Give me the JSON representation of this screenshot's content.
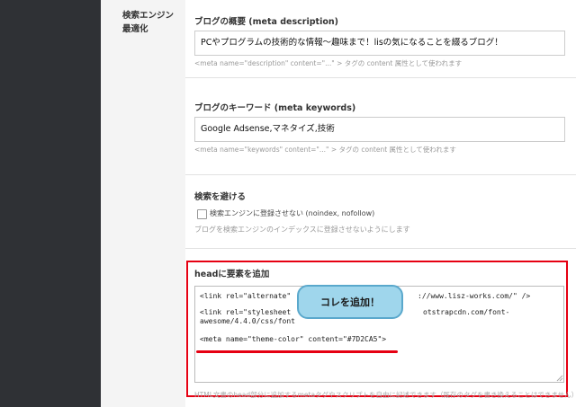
{
  "section_label": "検索エンジン最適化",
  "description": {
    "title": "ブログの概要 (meta description)",
    "value": "PCやプログラムの技術的な情報～趣味まで！lisの気になることを綴るブログ！",
    "hint": "<meta name=\"description\" content=\"...\" > タグの content 属性として使われます"
  },
  "keywords": {
    "title": "ブログのキーワード (meta keywords)",
    "value": "Google Adsense,マネタイズ,技術",
    "hint": "<meta name=\"keywords\" content=\"...\" > タグの content 属性として使われます"
  },
  "noindex": {
    "title": "検索を避ける",
    "checkbox_label": "検索エンジンに登録させない (noindex, nofollow)",
    "checked": false,
    "hint": "ブログを検索エンジンのインデックスに登録させないようにします"
  },
  "head": {
    "title": "headに要素を追加",
    "line1_left": "<link rel=\"alternate\"",
    "line1_right": "://www.lisz-works.com/\" />",
    "line2_left": "<link rel=\"stylesheet",
    "line2_right": "otstrapcdn.com/font-",
    "line3": "awesome/4.4.0/css/font",
    "line4": "<meta name=\"theme-color\" content=\"#7D2CA5\">",
    "hint": "HTML文書のhead部分に追加するmetaタグやスクリプトを自由に記述できます（既存のタグを書き換えることはできません）"
  },
  "callout": "コレを追加！"
}
